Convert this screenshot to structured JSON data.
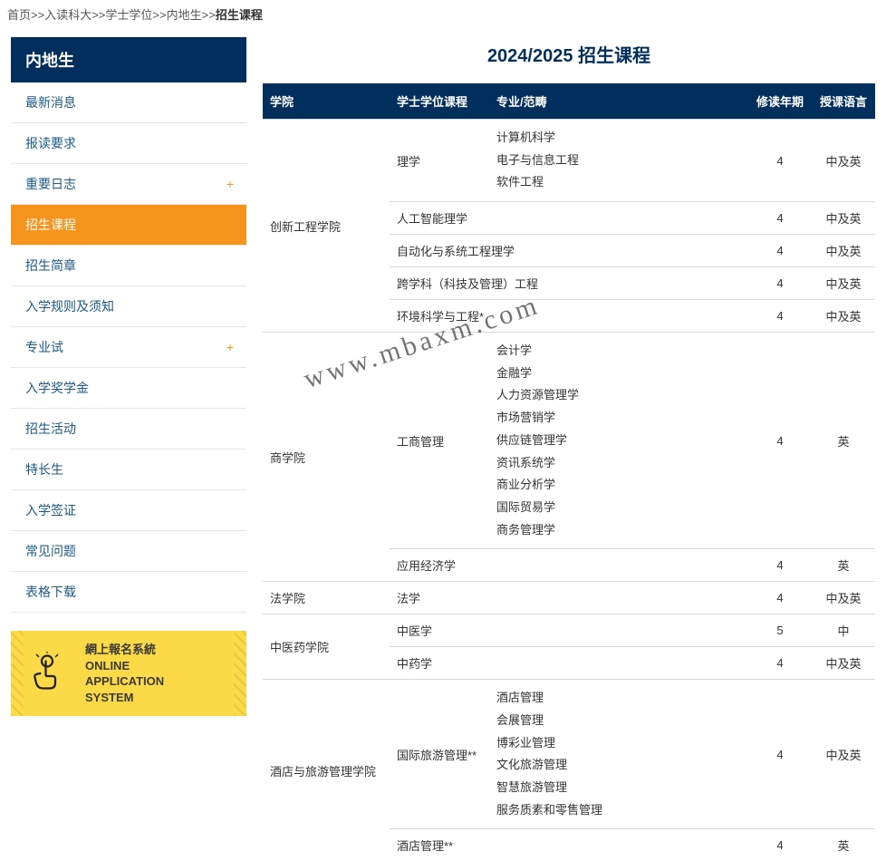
{
  "breadcrumb": {
    "items": [
      "首页",
      "入读科大",
      "学士学位",
      "内地生"
    ],
    "current": "招生课程",
    "sep": ">>"
  },
  "sidebar": {
    "header": "内地生",
    "items": [
      {
        "label": "最新消息",
        "expandable": false,
        "active": false
      },
      {
        "label": "报读要求",
        "expandable": false,
        "active": false
      },
      {
        "label": "重要日志",
        "expandable": true,
        "active": false
      },
      {
        "label": "招生课程",
        "expandable": false,
        "active": true
      },
      {
        "label": "招生简章",
        "expandable": false,
        "active": false
      },
      {
        "label": "入学规则及须知",
        "expandable": false,
        "active": false
      },
      {
        "label": "专业试",
        "expandable": true,
        "active": false
      },
      {
        "label": "入学奖学金",
        "expandable": false,
        "active": false
      },
      {
        "label": "招生活动",
        "expandable": false,
        "active": false
      },
      {
        "label": "特长生",
        "expandable": false,
        "active": false
      },
      {
        "label": "入学签证",
        "expandable": false,
        "active": false
      },
      {
        "label": "常见问题",
        "expandable": false,
        "active": false
      },
      {
        "label": "表格下载",
        "expandable": false,
        "active": false
      }
    ]
  },
  "promo": {
    "line1": "網上報名系統",
    "line2": "ONLINE",
    "line3": "APPLICATION",
    "line4": "SYSTEM"
  },
  "page": {
    "title": "2024/2025 招生课程"
  },
  "table": {
    "headers": {
      "faculty": "学院",
      "program": "学士学位课程",
      "major": "专业/范畴",
      "years": "修读年期",
      "lang": "授课语言"
    },
    "rows": [
      {
        "faculty": "创新工程学院",
        "program": "理学",
        "majors": [
          "计算机科学",
          "电子与信息工程",
          "软件工程"
        ],
        "years": "4",
        "lang": "中及英"
      },
      {
        "faculty": "",
        "program": "人工智能理学",
        "majors": [],
        "years": "4",
        "lang": "中及英"
      },
      {
        "faculty": "",
        "program": "自动化与系统工程理学",
        "majors": [],
        "years": "4",
        "lang": "中及英"
      },
      {
        "faculty": "",
        "program": "跨学科（科技及管理）工程",
        "majors": [],
        "years": "4",
        "lang": "中及英"
      },
      {
        "faculty": "",
        "program": "环境科学与工程*",
        "majors": [],
        "years": "4",
        "lang": "中及英"
      },
      {
        "faculty": "商学院",
        "program": "工商管理",
        "majors": [
          "会计学",
          "金融学",
          "人力资源管理学",
          "市场营销学",
          "供应链管理学",
          "资讯系统学",
          "商业分析学",
          "国际贸易学",
          "商务管理学"
        ],
        "years": "4",
        "lang": "英"
      },
      {
        "faculty": "",
        "program": "应用经济学",
        "majors": [],
        "years": "4",
        "lang": "英"
      },
      {
        "faculty": "法学院",
        "program": "法学",
        "majors": [],
        "years": "4",
        "lang": "中及英"
      },
      {
        "faculty": "中医药学院",
        "program": "中医学",
        "majors": [],
        "years": "5",
        "lang": "中"
      },
      {
        "faculty": "",
        "program": "中药学",
        "majors": [],
        "years": "4",
        "lang": "中及英"
      },
      {
        "faculty": "酒店与旅游管理学院",
        "program": "国际旅游管理**",
        "majors": [
          "酒店管理",
          "会展管理",
          "博彩业管理",
          "文化旅游管理",
          "智慧旅游管理",
          "服务质素和零售管理"
        ],
        "years": "4",
        "lang": "中及英"
      },
      {
        "faculty": "",
        "program": "酒店管理**",
        "majors": [],
        "years": "4",
        "lang": "英"
      }
    ]
  },
  "watermark": "www.mbaxm.com",
  "rowspans": {
    "faculty_0": 5,
    "faculty_5": 2,
    "faculty_8": 2,
    "faculty_10": 2
  }
}
